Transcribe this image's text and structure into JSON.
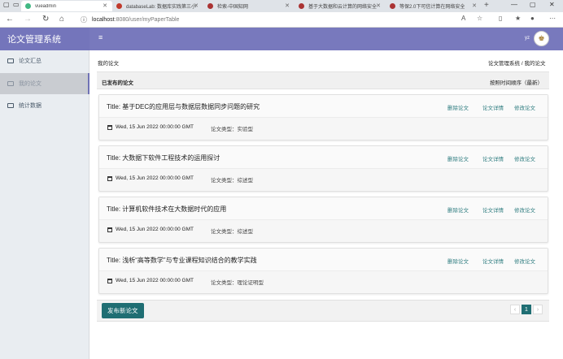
{
  "browser": {
    "tabs": [
      {
        "title": "vueadmin",
        "active": true,
        "color": "#41b883"
      },
      {
        "title": "databaseLab: 数据库实践第三小",
        "active": false,
        "color": "#c0392b"
      },
      {
        "title": "检索-中国知网",
        "active": false,
        "color": "#a33"
      },
      {
        "title": "基于大数据和云计算的网络安全",
        "active": false,
        "color": "#a33"
      },
      {
        "title": "等保2.0下可信计算在网络安全",
        "active": false,
        "color": "#a33"
      }
    ],
    "url_host": "localhost",
    "url_path": ":8080/user/myPaperTable"
  },
  "app": {
    "brand": "论文管理系统",
    "user": "yz"
  },
  "sidebar": {
    "items": [
      {
        "label": "论文汇总",
        "active": false
      },
      {
        "label": "我的论文",
        "active": true
      },
      {
        "label": "统计数据",
        "active": false
      }
    ]
  },
  "breadcrumb": {
    "page": "我的论文",
    "root": "论文管理系统",
    "current": "我的论文"
  },
  "section": {
    "title": "已发布的论文",
    "sort": "按照时间顺序（最新）"
  },
  "papers": [
    {
      "title": "Title: 基于DEC的应用层与数据层数据同步问题的研究",
      "date": "Wed, 15 Jun 2022 00:00:00 GMT",
      "type": "论文类型：实验型",
      "actions": [
        "删除论文",
        "论文详情",
        "修改论文"
      ]
    },
    {
      "title": "Title: 大数据下软件工程技术的运用探讨",
      "date": "Wed, 15 Jun 2022 00:00:00 GMT",
      "type": "论文类型：综述型",
      "actions": [
        "删除论文",
        "论文详情",
        "修改论文"
      ]
    },
    {
      "title": "Title: 计算机软件技术在大数据时代的应用",
      "date": "Wed, 15 Jun 2022 00:00:00 GMT",
      "type": "论文类型：综述型",
      "actions": [
        "删除论文",
        "论文详情",
        "修改论文"
      ]
    },
    {
      "title": "Title: 浅析“高等数学”与专业课程知识结合的教学实践",
      "date": "Wed, 15 Jun 2022 00:00:00 GMT",
      "type": "论文类型：理论证明型",
      "actions": [
        "删除论文",
        "论文详情",
        "修改论文"
      ]
    }
  ],
  "footer": {
    "new_button": "发布新论文",
    "page": "1"
  },
  "colors": {
    "header": "#7879bd",
    "accent": "#1f6e73",
    "link": "#2f7d80"
  }
}
